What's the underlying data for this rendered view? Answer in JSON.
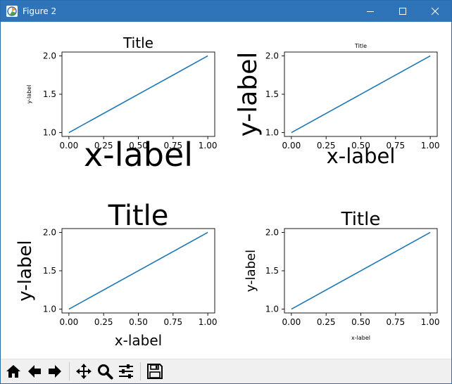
{
  "window": {
    "title": "Figure 2",
    "app_icon": "matplotlib-figure-icon",
    "controls": [
      "minimize-icon",
      "maximize-icon",
      "close-icon"
    ]
  },
  "toolbar": {
    "buttons": [
      {
        "name": "home",
        "icon": "home-icon"
      },
      {
        "name": "back",
        "icon": "arrow-left-icon"
      },
      {
        "name": "forward",
        "icon": "arrow-right-icon"
      },
      {
        "name": "pan",
        "icon": "move-icon"
      },
      {
        "name": "zoom",
        "icon": "magnifier-icon"
      },
      {
        "name": "configure-subplots",
        "icon": "sliders-icon"
      },
      {
        "name": "save",
        "icon": "save-icon"
      }
    ]
  },
  "colors": {
    "titlebar": "#2f74b8",
    "line": "#1f77b4",
    "toolbar": "#f0f0f0"
  },
  "chart_data": [
    {
      "type": "line",
      "title": "Title",
      "xlabel": "x-label",
      "ylabel": "y-label",
      "series": [
        {
          "x": [
            0,
            1
          ],
          "y": [
            1,
            2
          ]
        }
      ],
      "xlim": [
        -0.05,
        1.05
      ],
      "ylim": [
        0.95,
        2.05
      ],
      "xticks": [
        "0.00",
        "0.25",
        "0.50",
        "0.75",
        "1.00"
      ],
      "yticks": [
        "1.0",
        "1.5",
        "2.0"
      ],
      "grid": false
    },
    {
      "type": "line",
      "title": "Title",
      "xlabel": "x-label",
      "ylabel": "y-label",
      "series": [
        {
          "x": [
            0,
            1
          ],
          "y": [
            1,
            2
          ]
        }
      ],
      "xlim": [
        -0.05,
        1.05
      ],
      "ylim": [
        0.95,
        2.05
      ],
      "xticks": [
        "0.00",
        "0.25",
        "0.50",
        "0.75",
        "1.00"
      ],
      "yticks": [
        "1.0",
        "1.5",
        "2.0"
      ],
      "grid": false
    },
    {
      "type": "line",
      "title": "Title",
      "xlabel": "x-label",
      "ylabel": "y-label",
      "series": [
        {
          "x": [
            0,
            1
          ],
          "y": [
            1,
            2
          ]
        }
      ],
      "xlim": [
        -0.05,
        1.05
      ],
      "ylim": [
        0.95,
        2.05
      ],
      "xticks": [
        "0.00",
        "0.25",
        "0.50",
        "0.75",
        "1.00"
      ],
      "yticks": [
        "1.0",
        "1.5",
        "2.0"
      ],
      "grid": false
    },
    {
      "type": "line",
      "title": "Title",
      "xlabel": "x-label",
      "ylabel": "y-label",
      "series": [
        {
          "x": [
            0,
            1
          ],
          "y": [
            1,
            2
          ]
        }
      ],
      "xlim": [
        -0.05,
        1.05
      ],
      "ylim": [
        0.95,
        2.05
      ],
      "xticks": [
        "0.00",
        "0.25",
        "0.50",
        "0.75",
        "1.00"
      ],
      "yticks": [
        "1.0",
        "1.5",
        "2.0"
      ],
      "grid": false
    }
  ]
}
